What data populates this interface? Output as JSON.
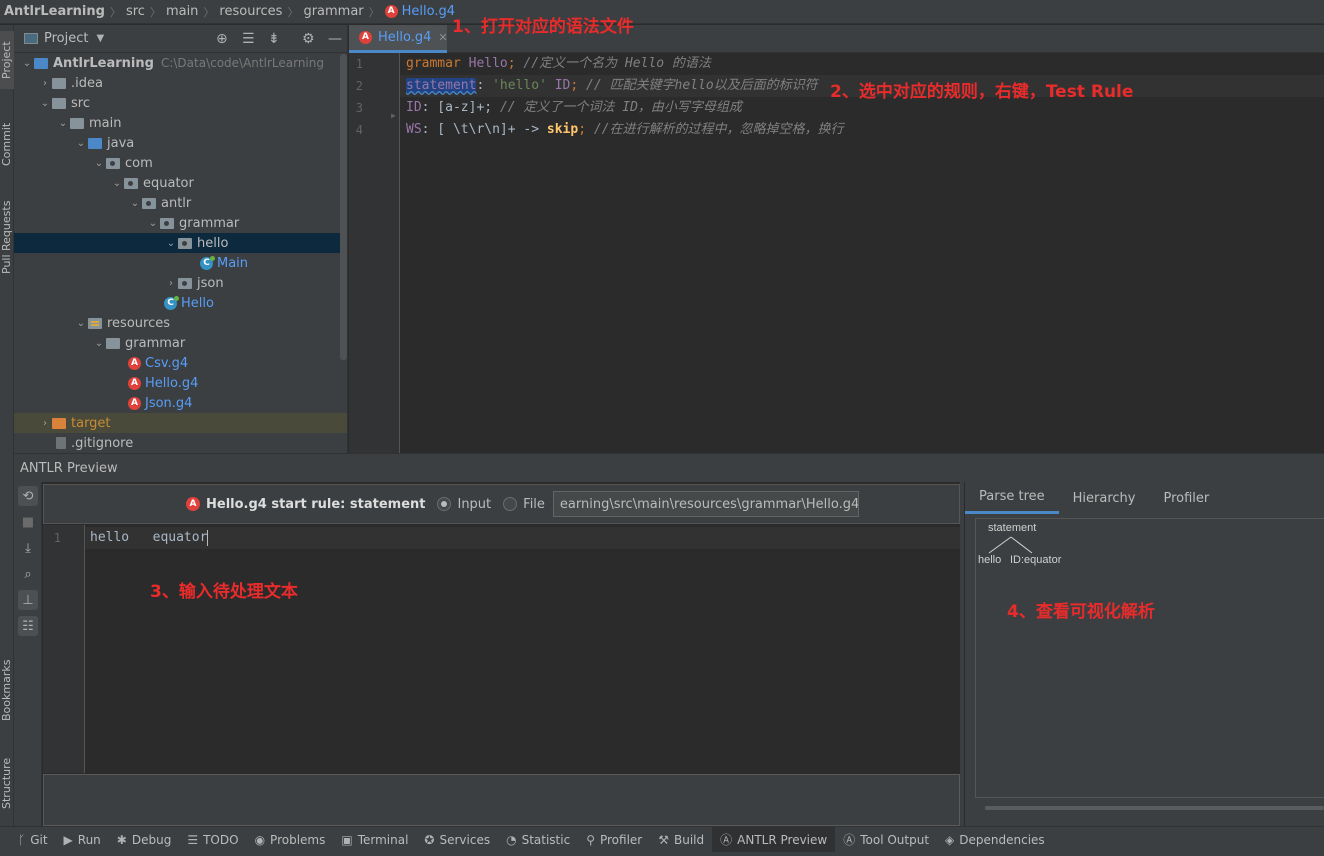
{
  "breadcrumb": {
    "items": [
      "AntlrLearning",
      "src",
      "main",
      "resources",
      "grammar"
    ],
    "file": "Hello.g4"
  },
  "left_strip": {
    "project": "Project",
    "commit": "Commit",
    "pull_requests": "Pull Requests",
    "bookmarks": "Bookmarks",
    "structure": "Structure"
  },
  "project_panel": {
    "title": "Project",
    "root_name": "AntlrLearning",
    "root_path": "C:\\Data\\code\\AntlrLearning",
    "tree": [
      {
        "label": "AntlrLearning",
        "kind": "root"
      },
      {
        "label": ".idea"
      },
      {
        "label": "src"
      },
      {
        "label": "main"
      },
      {
        "label": "java"
      },
      {
        "label": "com"
      },
      {
        "label": "equator"
      },
      {
        "label": "antlr"
      },
      {
        "label": "grammar"
      },
      {
        "label": "hello"
      },
      {
        "label": "Main"
      },
      {
        "label": "json"
      },
      {
        "label": "Hello"
      },
      {
        "label": "resources"
      },
      {
        "label": "grammar"
      },
      {
        "label": "Csv.g4"
      },
      {
        "label": "Hello.g4"
      },
      {
        "label": "Json.g4"
      },
      {
        "label": "target"
      },
      {
        "label": ".gitignore"
      }
    ]
  },
  "editor": {
    "tab": "Hello.g4",
    "line_numbers": [
      "1",
      "2",
      "3",
      "4"
    ],
    "lines": [
      {
        "a": "grammar",
        "b": " Hello",
        "c": "; ",
        "d": "//定义一个名为 Hello 的语法"
      },
      {
        "a": "statement",
        "b": ": ",
        "c": "'hello'",
        "d": " ID",
        "e": "; ",
        "f": "// 匹配关键字hello以及后面的标识符"
      },
      {
        "a": "ID",
        "b": ": [a-z]+; ",
        "c": "// 定义了一个词法 ID，由小写字母组成"
      },
      {
        "a": "WS",
        "b": ": [ \\t\\r\\n]+ -> ",
        "c": "skip",
        "d": "; ",
        "e": "//在进行解析的过程中，忽略掉空格，换行"
      }
    ]
  },
  "annotations": {
    "a1": "1、打开对应的语法文件",
    "a2": "2、选中对应的规则，右键，Test Rule",
    "a3": "3、输入待处理文本",
    "a4": "4、查看可视化解析"
  },
  "preview": {
    "title": "ANTLR Preview",
    "rule_text": "Hello.g4 start rule: statement",
    "input_label": "Input",
    "file_label": "File",
    "input_selected": "Input",
    "path": "earning\\src\\main\\resources\\grammar\\Hello.g4",
    "line_number": "1",
    "input_text": "hello   equator",
    "tabs": [
      "Parse tree",
      "Hierarchy",
      "Profiler"
    ],
    "selected_tab": "Parse tree",
    "parse_tree": {
      "root": "statement",
      "left": "hello",
      "right": "ID:equator"
    }
  },
  "toolbar": {
    "items": [
      "Git",
      "Run",
      "Debug",
      "TODO",
      "Problems",
      "Terminal",
      "Services",
      "Statistic",
      "Profiler",
      "Build",
      "ANTLR Preview",
      "Tool Output",
      "Dependencies"
    ],
    "selected": "ANTLR Preview"
  }
}
